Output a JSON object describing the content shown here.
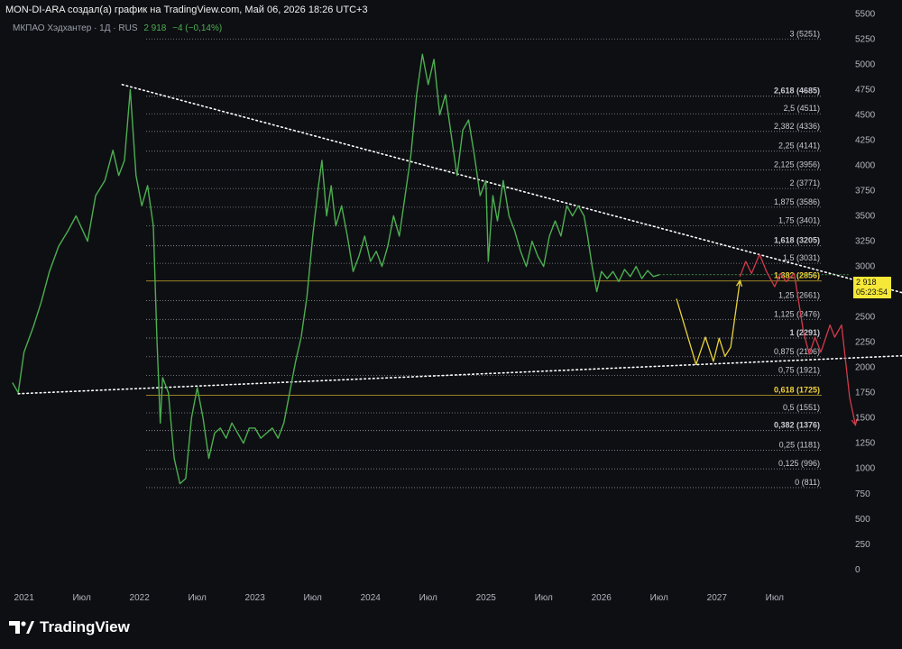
{
  "header": {
    "attribution": "MON-DI-ARA создал(а) график на TradingView.com, Май 06, 2026 18:26 UTC+3",
    "symbol": "МКПАО Хэдхантер · 1Д · RUS",
    "last_price": "2 918",
    "change": "−4 (−0,14%)"
  },
  "price_tag": {
    "price": "2 918",
    "countdown": "05:23:54"
  },
  "brand": {
    "name": "TradingView"
  },
  "colors": {
    "background": "#0e0f13",
    "price_line": "#4caf50",
    "forecast_yellow": "#e8d13a",
    "forecast_red": "#d43a4a",
    "trendline": "#ffffff",
    "fib_line": "#8a8d96",
    "fib_highlight": "#c8a92a"
  },
  "chart_data": {
    "type": "line",
    "x_axis": {
      "ticks": [
        "2021",
        "Июл",
        "2022",
        "Июл",
        "2023",
        "Июл",
        "2024",
        "Июл",
        "2025",
        "Июл",
        "2026",
        "Июл",
        "2027",
        "Июл"
      ],
      "tick_times": [
        2021.0,
        2021.5,
        2022.0,
        2022.5,
        2023.0,
        2023.5,
        2024.0,
        2024.5,
        2025.0,
        2025.5,
        2026.0,
        2026.5,
        2027.0,
        2027.5
      ]
    },
    "y_axis": {
      "ticks": [
        "5500",
        "5250",
        "5000",
        "4750",
        "4500",
        "4250",
        "4000",
        "3750",
        "3500",
        "3250",
        "3000",
        "2750",
        "2500",
        "2250",
        "2000",
        "1750",
        "1500",
        "1250",
        "1000",
        "750",
        "500",
        "250",
        "0"
      ],
      "tick_values": [
        5500,
        5250,
        5000,
        4750,
        4500,
        4250,
        4000,
        3750,
        3500,
        3250,
        3000,
        2750,
        2500,
        2250,
        2000,
        1750,
        1500,
        1250,
        1000,
        750,
        500,
        250,
        0
      ],
      "range": [
        -180,
        5530
      ]
    },
    "x_range": [
      2020.87,
      2028.15
    ],
    "series": [
      {
        "points": [
          [
            2020.9,
            1850
          ],
          [
            2020.95,
            1750
          ],
          [
            2021.0,
            2150
          ],
          [
            2021.08,
            2400
          ],
          [
            2021.15,
            2650
          ],
          [
            2021.22,
            2950
          ],
          [
            2021.3,
            3200
          ],
          [
            2021.38,
            3350
          ],
          [
            2021.45,
            3500
          ],
          [
            2021.55,
            3250
          ],
          [
            2021.62,
            3700
          ],
          [
            2021.7,
            3850
          ],
          [
            2021.77,
            4150
          ],
          [
            2021.82,
            3900
          ],
          [
            2021.87,
            4050
          ],
          [
            2021.92,
            4750
          ],
          [
            2021.97,
            3900
          ],
          [
            2022.02,
            3600
          ],
          [
            2022.07,
            3800
          ],
          [
            2022.12,
            3400
          ],
          [
            2022.15,
            2300
          ],
          [
            2022.18,
            1450
          ],
          [
            2022.2,
            1900
          ],
          [
            2022.25,
            1750
          ],
          [
            2022.3,
            1100
          ],
          [
            2022.35,
            850
          ],
          [
            2022.4,
            900
          ],
          [
            2022.45,
            1500
          ],
          [
            2022.5,
            1800
          ],
          [
            2022.55,
            1500
          ],
          [
            2022.6,
            1100
          ],
          [
            2022.65,
            1350
          ],
          [
            2022.7,
            1400
          ],
          [
            2022.75,
            1300
          ],
          [
            2022.8,
            1450
          ],
          [
            2022.85,
            1350
          ],
          [
            2022.9,
            1250
          ],
          [
            2022.95,
            1400
          ],
          [
            2023.0,
            1400
          ],
          [
            2023.05,
            1300
          ],
          [
            2023.1,
            1350
          ],
          [
            2023.15,
            1400
          ],
          [
            2023.2,
            1300
          ],
          [
            2023.25,
            1450
          ],
          [
            2023.3,
            1750
          ],
          [
            2023.35,
            2050
          ],
          [
            2023.4,
            2300
          ],
          [
            2023.45,
            2700
          ],
          [
            2023.5,
            3300
          ],
          [
            2023.55,
            3800
          ],
          [
            2023.58,
            4050
          ],
          [
            2023.62,
            3500
          ],
          [
            2023.66,
            3800
          ],
          [
            2023.7,
            3400
          ],
          [
            2023.75,
            3600
          ],
          [
            2023.8,
            3300
          ],
          [
            2023.85,
            2950
          ],
          [
            2023.9,
            3100
          ],
          [
            2023.95,
            3300
          ],
          [
            2024.0,
            3050
          ],
          [
            2024.05,
            3150
          ],
          [
            2024.1,
            3000
          ],
          [
            2024.15,
            3200
          ],
          [
            2024.2,
            3500
          ],
          [
            2024.25,
            3300
          ],
          [
            2024.3,
            3700
          ],
          [
            2024.35,
            4100
          ],
          [
            2024.4,
            4700
          ],
          [
            2024.45,
            5100
          ],
          [
            2024.5,
            4800
          ],
          [
            2024.55,
            5050
          ],
          [
            2024.6,
            4500
          ],
          [
            2024.65,
            4700
          ],
          [
            2024.7,
            4300
          ],
          [
            2024.75,
            3900
          ],
          [
            2024.8,
            4350
          ],
          [
            2024.85,
            4450
          ],
          [
            2024.9,
            4100
          ],
          [
            2024.95,
            3700
          ],
          [
            2025.0,
            3850
          ],
          [
            2025.02,
            3050
          ],
          [
            2025.06,
            3700
          ],
          [
            2025.1,
            3450
          ],
          [
            2025.15,
            3850
          ],
          [
            2025.2,
            3500
          ],
          [
            2025.25,
            3350
          ],
          [
            2025.3,
            3150
          ],
          [
            2025.35,
            3000
          ],
          [
            2025.4,
            3250
          ],
          [
            2025.45,
            3100
          ],
          [
            2025.5,
            3000
          ],
          [
            2025.55,
            3300
          ],
          [
            2025.6,
            3450
          ],
          [
            2025.65,
            3300
          ],
          [
            2025.7,
            3600
          ],
          [
            2025.75,
            3500
          ],
          [
            2025.8,
            3600
          ],
          [
            2025.85,
            3500
          ],
          [
            2025.88,
            3300
          ],
          [
            2025.92,
            3000
          ],
          [
            2025.96,
            2750
          ],
          [
            2026.0,
            2950
          ],
          [
            2026.05,
            2880
          ],
          [
            2026.1,
            2950
          ],
          [
            2026.15,
            2850
          ],
          [
            2026.2,
            2970
          ],
          [
            2026.25,
            2900
          ],
          [
            2026.3,
            3000
          ],
          [
            2026.35,
            2880
          ],
          [
            2026.4,
            2960
          ],
          [
            2026.45,
            2900
          ],
          [
            2026.5,
            2918
          ]
        ]
      }
    ],
    "projection_up": [
      [
        2026.65,
        2680
      ],
      [
        2026.82,
        2030
      ],
      [
        2026.9,
        2300
      ],
      [
        2026.97,
        2060
      ],
      [
        2027.02,
        2290
      ],
      [
        2027.07,
        2110
      ],
      [
        2027.12,
        2200
      ],
      [
        2027.2,
        2860
      ]
    ],
    "projection_down": [
      [
        2027.2,
        2900
      ],
      [
        2027.25,
        3050
      ],
      [
        2027.3,
        2930
      ],
      [
        2027.37,
        3120
      ],
      [
        2027.43,
        2950
      ],
      [
        2027.5,
        2800
      ],
      [
        2027.55,
        2930
      ],
      [
        2027.6,
        2850
      ],
      [
        2027.67,
        2930
      ],
      [
        2027.75,
        2350
      ],
      [
        2027.8,
        2130
      ],
      [
        2027.85,
        2300
      ],
      [
        2027.9,
        2150
      ],
      [
        2027.98,
        2420
      ],
      [
        2028.02,
        2300
      ],
      [
        2028.08,
        2420
      ],
      [
        2028.15,
        1700
      ],
      [
        2028.2,
        1430
      ]
    ],
    "trendline_upper": [
      [
        2021.85,
        4800
      ],
      [
        2028.9,
        2650
      ]
    ],
    "trendline_lower": [
      [
        2020.95,
        1740
      ],
      [
        2028.9,
        2130
      ]
    ],
    "fib_levels": [
      {
        "label": "3 (5251)",
        "value": 5251,
        "style": "plain"
      },
      {
        "label": "2,618 (4685)",
        "value": 4685,
        "style": "bold"
      },
      {
        "label": "2,5 (4511)",
        "value": 4511,
        "style": "plain"
      },
      {
        "label": "2,382 (4336)",
        "value": 4336,
        "style": "plain"
      },
      {
        "label": "2,25 (4141)",
        "value": 4141,
        "style": "plain"
      },
      {
        "label": "2,125 (3956)",
        "value": 3956,
        "style": "plain"
      },
      {
        "label": "2 (3771)",
        "value": 3771,
        "style": "plain"
      },
      {
        "label": "1,875 (3586)",
        "value": 3586,
        "style": "plain"
      },
      {
        "label": "1,75 (3401)",
        "value": 3401,
        "style": "plain"
      },
      {
        "label": "1,618 (3205)",
        "value": 3205,
        "style": "bold"
      },
      {
        "label": "1,5 (3031)",
        "value": 3031,
        "style": "plain"
      },
      {
        "label": "1,382 (2856)",
        "value": 2856,
        "style": "gold"
      },
      {
        "label": "1,25 (2661)",
        "value": 2661,
        "style": "plain"
      },
      {
        "label": "1,125 (2476)",
        "value": 2476,
        "style": "plain"
      },
      {
        "label": "1 (2291)",
        "value": 2291,
        "style": "bold"
      },
      {
        "label": "0,875 (2106)",
        "value": 2106,
        "style": "plain"
      },
      {
        "label": "0,75 (1921)",
        "value": 1921,
        "style": "plain"
      },
      {
        "label": "0,618 (1725)",
        "value": 1725,
        "style": "gold"
      },
      {
        "label": "0,5 (1551)",
        "value": 1551,
        "style": "plain"
      },
      {
        "label": "0,382 (1376)",
        "value": 1376,
        "style": "bold"
      },
      {
        "label": "0,25 (1181)",
        "value": 1181,
        "style": "plain"
      },
      {
        "label": "0,125 (996)",
        "value": 996,
        "style": "plain"
      },
      {
        "label": "0 (811)",
        "value": 811,
        "style": "plain"
      }
    ]
  }
}
